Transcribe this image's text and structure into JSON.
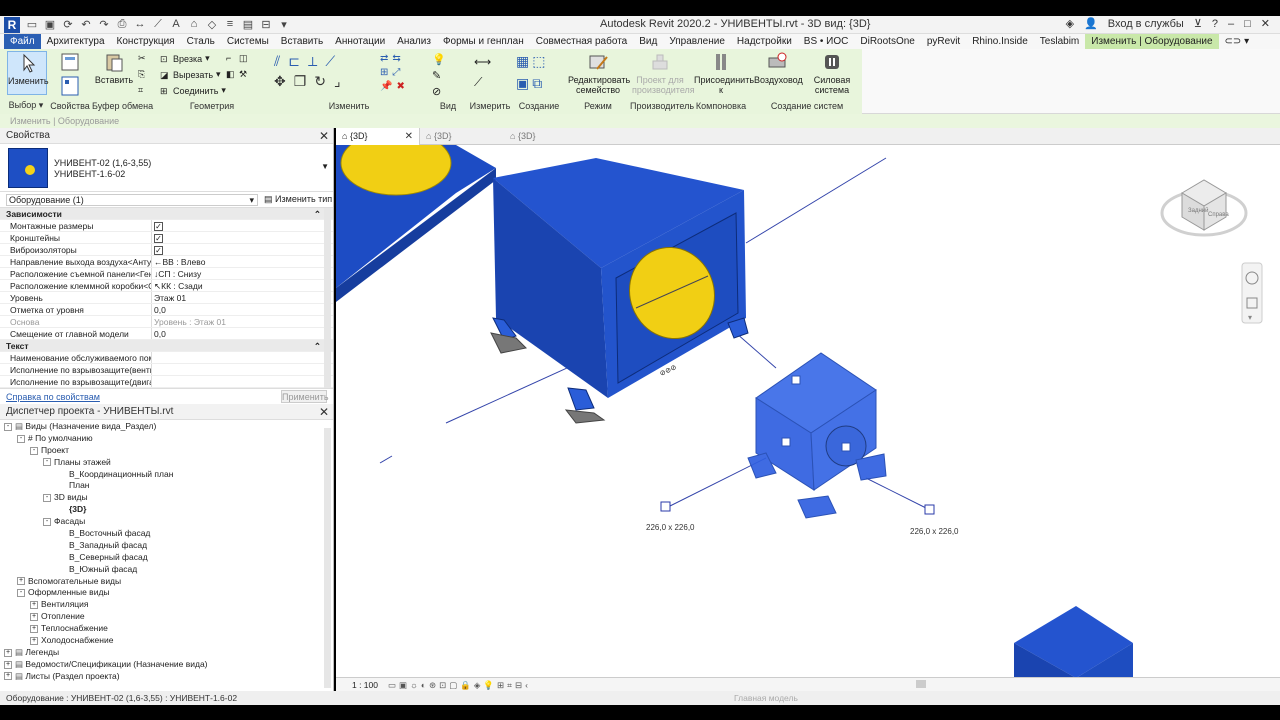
{
  "app": {
    "logo": "R",
    "title": "Autodesk Revit 2020.2 - УНИВЕНТЫ.rvt - 3D вид: {3D}",
    "signin": "Вход в службы",
    "qat_icons": [
      "open-icon",
      "save-icon",
      "undo-icon",
      "redo-icon",
      "print-icon",
      "measure-icon",
      "text-icon",
      "3d-icon",
      "section-icon",
      "thin-lines-icon",
      "close-hidden-icon",
      "switch-windows-icon"
    ]
  },
  "menu": {
    "tabs": [
      "Файл",
      "Архитектура",
      "Конструкция",
      "Сталь",
      "Системы",
      "Вставить",
      "Аннотации",
      "Анализ",
      "Формы и генплан",
      "Совместная работа",
      "Вид",
      "Управление",
      "Надстройки",
      "BS • ИОС",
      "DiRootsOne",
      "pyRevit",
      "Rhino.Inside",
      "Teslabim",
      "Изменить | Оборудование"
    ]
  },
  "ribbon": {
    "modify": "Изменить",
    "select": "Выбор",
    "properties": "Свойства",
    "paste": "Вставить",
    "clipboard": "Буфер обмена",
    "cut_in": "Врезка",
    "cut": "Вырезать",
    "join": "Соединить",
    "geometry": "Геометрия",
    "modify_group": "Изменить",
    "view": "Вид",
    "measure": "Измерить",
    "create": "Создание",
    "edit_family": "Редактировать семейство",
    "mode": "Режим",
    "manufacturer_project": "Проект для производителя",
    "manufacturer": "Производитель",
    "connect_to": "Присоединить к",
    "layout": "Компоновка",
    "duct": "Воздуховод",
    "power_system": "Силовая система",
    "create_systems": "Создание систем"
  },
  "options_bar": "Изменить | Оборудование",
  "properties_panel": {
    "title": "Свойства",
    "type_name_1": "УНИВЕНТ-02 (1,6-3,55)",
    "type_name_2": "УНИВЕНТ-1.6-02",
    "filter": "Оборудование (1)",
    "edit_type": "Изменить тип",
    "rows": [
      {
        "k": "Зависимости",
        "v": "",
        "cat": true
      },
      {
        "k": "Монтажные размеры",
        "v": "",
        "chk": true
      },
      {
        "k": "Кронштейны",
        "v": "",
        "chk": true
      },
      {
        "k": "Виброизоляторы",
        "v": "",
        "chk": true
      },
      {
        "k": "Направление выхода воздуха<Антура...",
        "v": "←ВВ : Влево"
      },
      {
        "k": "Расположение съемной панели<Генп...",
        "v": "↓СП : Снизу"
      },
      {
        "k": "Расположение клеммной коробки<О...",
        "v": "↖КК : Сзади"
      },
      {
        "k": "Уровень",
        "v": "Этаж 01"
      },
      {
        "k": "Отметка от уровня",
        "v": "0,0"
      },
      {
        "k": "Основа",
        "v": "Уровень : Этаж 01",
        "muted": true
      },
      {
        "k": "Смещение от главной модели",
        "v": "0,0"
      },
      {
        "k": "Текст",
        "v": "",
        "cat": true
      },
      {
        "k": "Наименование обслуживаемого поме...",
        "v": ""
      },
      {
        "k": "Исполнение по взрывозащите(вентил...",
        "v": ""
      },
      {
        "k": "Исполнение по взрывозащите(двигат...",
        "v": ""
      }
    ],
    "help": "Справка по свойствам",
    "apply": "Применить"
  },
  "project_browser": {
    "title": "Диспетчер проекта - УНИВЕНТЫ.rvt",
    "items": [
      {
        "label": "Виды (Назначение вида_Раздел)",
        "level": 0,
        "ex": "-",
        "icon": true
      },
      {
        "label": "# По умолчанию",
        "level": 1,
        "ex": "-"
      },
      {
        "label": "Проект",
        "level": 2,
        "ex": "-"
      },
      {
        "label": "Планы этажей",
        "level": 3,
        "ex": "-"
      },
      {
        "label": "В_Координационный план",
        "level": 5,
        "ex": ""
      },
      {
        "label": "План",
        "level": 5,
        "ex": ""
      },
      {
        "label": "3D виды",
        "level": 3,
        "ex": "-"
      },
      {
        "label": "{3D}",
        "level": 5,
        "ex": "",
        "bold": true
      },
      {
        "label": "Фасады",
        "level": 3,
        "ex": "-"
      },
      {
        "label": "В_Восточный фасад",
        "level": 5,
        "ex": ""
      },
      {
        "label": "В_Западный фасад",
        "level": 5,
        "ex": ""
      },
      {
        "label": "В_Северный фасад",
        "level": 5,
        "ex": ""
      },
      {
        "label": "В_Южный фасад",
        "level": 5,
        "ex": ""
      },
      {
        "label": "Вспомогательные виды",
        "level": 1,
        "ex": "+"
      },
      {
        "label": "Оформленные виды",
        "level": 1,
        "ex": "-"
      },
      {
        "label": "Вентиляция",
        "level": 2,
        "ex": "+"
      },
      {
        "label": "Отопление",
        "level": 2,
        "ex": "+"
      },
      {
        "label": "Теплоснабжение",
        "level": 2,
        "ex": "+"
      },
      {
        "label": "Холодоснабжение",
        "level": 2,
        "ex": "+"
      },
      {
        "label": "Легенды",
        "level": 0,
        "ex": "+",
        "icon": true
      },
      {
        "label": "Ведомости/Спецификации (Назначение вида)",
        "level": 0,
        "ex": "+",
        "icon": true
      },
      {
        "label": "Листы (Раздел проекта)",
        "level": 0,
        "ex": "+",
        "icon": true
      }
    ]
  },
  "view": {
    "tabs": [
      "{3D}",
      "{3D}",
      "{3D}"
    ],
    "scale": "1 : 100",
    "dim1": "226,0 x 226,0",
    "dim2": "226,0 x 226,0",
    "viewcube_faces": [
      "Задний",
      "Справа"
    ]
  },
  "status": {
    "text": "Оборудование : УНИВЕНТ-02 (1,6-3,55) : УНИВЕНТ-1.6-02",
    "model": "Главная модель"
  },
  "colors": {
    "accent": "#2b5fb4",
    "context_tab": "#c9e8a9",
    "equipment_blue": "#1e4fc4",
    "fan_yellow": "#f4d21a"
  }
}
